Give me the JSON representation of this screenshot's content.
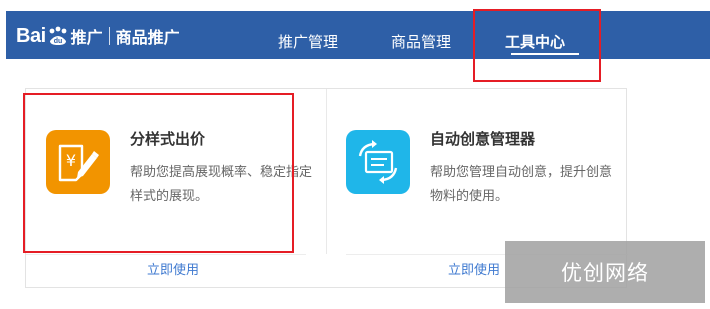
{
  "header": {
    "logo_brand_left": "Bai",
    "logo_brand_right": "du",
    "logo_suffix": "推广",
    "product_name": "商品推广",
    "nav": [
      {
        "label": "推广管理",
        "active": false
      },
      {
        "label": "商品管理",
        "active": false
      },
      {
        "label": "工具中心",
        "active": true
      }
    ]
  },
  "tools": [
    {
      "title": "分样式出价",
      "description": "帮助您提高展现概率、稳定指定样式的展现。",
      "link": "立即使用",
      "icon": "price-tag-pencil-icon",
      "icon_color": "#f29400"
    },
    {
      "title": "自动创意管理器",
      "description": "帮助您管理自动创意，提升创意物料的使用。",
      "link": "立即使用",
      "icon": "refresh-document-icon",
      "icon_color": "#1fb6e9"
    }
  ],
  "watermark": "优创网络",
  "colors": {
    "header_bg": "#2e5fa7",
    "highlight": "#e51d25",
    "link": "#3f7ad0"
  }
}
